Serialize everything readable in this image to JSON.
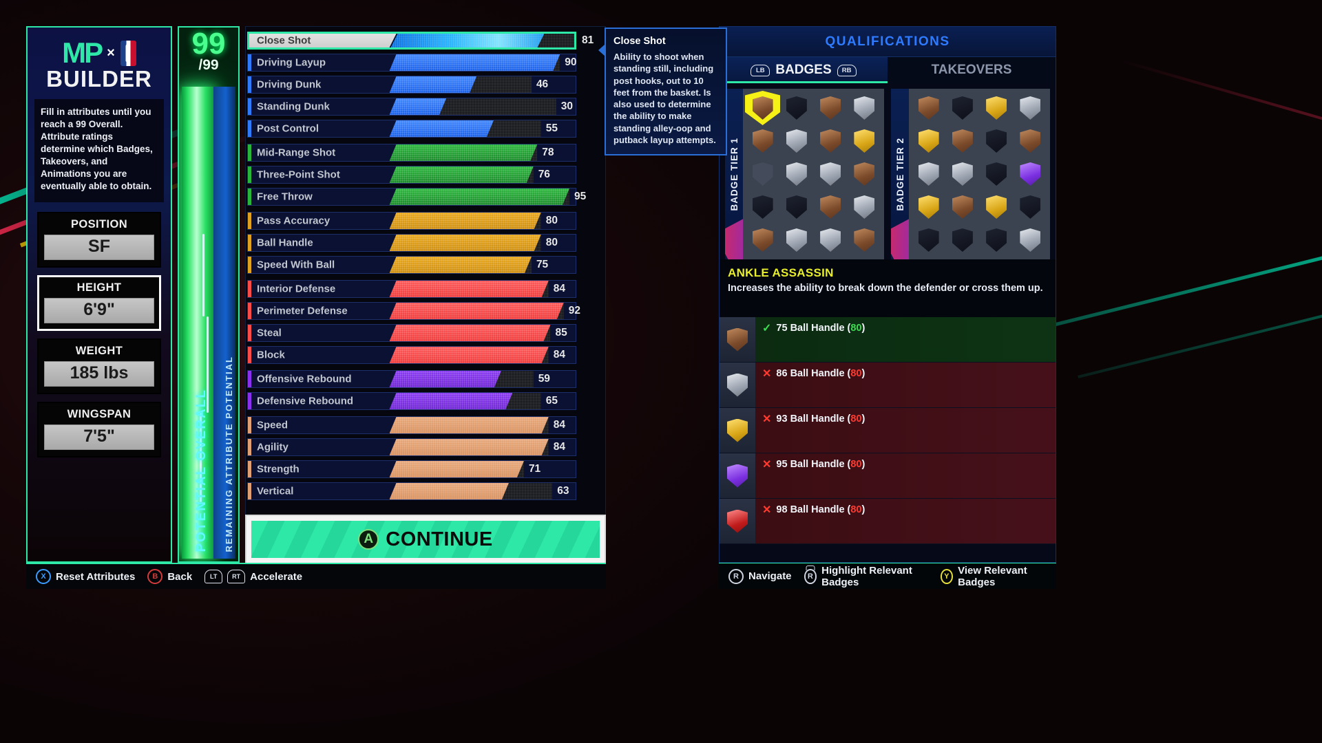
{
  "branding": {
    "mp_logo": "MP",
    "x_symbol": "×",
    "builder_word": "BUILDER",
    "description": "Fill in attributes until you reach a 99 Overall. Attribute ratings determine which Badges, Takeovers, and Animations you are eventually able to obtain."
  },
  "player": {
    "fields": [
      {
        "label": "POSITION",
        "value": "SF",
        "selected": false
      },
      {
        "label": "HEIGHT",
        "value": "6'9\"",
        "selected": true
      },
      {
        "label": "WEIGHT",
        "value": "185 lbs",
        "selected": false
      },
      {
        "label": "WINGSPAN",
        "value": "7'5\"",
        "selected": false
      }
    ]
  },
  "meter": {
    "overall": "99",
    "overall_max": "/99",
    "potential_label": "POTENTIAL OVERALL",
    "remaining_label": "REMAINING ATTRIBUTE POTENTIAL"
  },
  "attributes": [
    {
      "name": "Close Shot",
      "value": 81,
      "max": 99,
      "category": "inside",
      "selected": true,
      "gap": false
    },
    {
      "name": "Driving Layup",
      "value": 90,
      "max": 90,
      "category": "inside",
      "selected": false,
      "gap": false
    },
    {
      "name": "Driving Dunk",
      "value": 46,
      "max": 75,
      "category": "inside",
      "selected": false,
      "gap": false
    },
    {
      "name": "Standing Dunk",
      "value": 30,
      "max": 88,
      "category": "inside",
      "selected": false,
      "gap": false
    },
    {
      "name": "Post Control",
      "value": 55,
      "max": 80,
      "category": "inside",
      "selected": false,
      "gap": false
    },
    {
      "name": "Mid-Range Shot",
      "value": 78,
      "max": 78,
      "category": "shoot",
      "selected": false,
      "gap": true
    },
    {
      "name": "Three-Point Shot",
      "value": 76,
      "max": 76,
      "category": "shoot",
      "selected": false,
      "gap": false
    },
    {
      "name": "Free Throw",
      "value": 95,
      "max": 95,
      "category": "shoot",
      "selected": false,
      "gap": false
    },
    {
      "name": "Pass Accuracy",
      "value": 80,
      "max": 80,
      "category": "play",
      "selected": false,
      "gap": true
    },
    {
      "name": "Ball Handle",
      "value": 80,
      "max": 80,
      "category": "play",
      "selected": false,
      "gap": false
    },
    {
      "name": "Speed With Ball",
      "value": 75,
      "max": 75,
      "category": "play",
      "selected": false,
      "gap": false
    },
    {
      "name": "Interior Defense",
      "value": 84,
      "max": 84,
      "category": "def",
      "selected": false,
      "gap": true
    },
    {
      "name": "Perimeter Defense",
      "value": 92,
      "max": 92,
      "category": "def",
      "selected": false,
      "gap": false
    },
    {
      "name": "Steal",
      "value": 85,
      "max": 85,
      "category": "def",
      "selected": false,
      "gap": false
    },
    {
      "name": "Block",
      "value": 84,
      "max": 84,
      "category": "def",
      "selected": false,
      "gap": false
    },
    {
      "name": "Offensive Rebound",
      "value": 59,
      "max": 76,
      "category": "reb",
      "selected": false,
      "gap": true
    },
    {
      "name": "Defensive Rebound",
      "value": 65,
      "max": 80,
      "category": "reb",
      "selected": false,
      "gap": false
    },
    {
      "name": "Speed",
      "value": 84,
      "max": 84,
      "category": "ath",
      "selected": false,
      "gap": true
    },
    {
      "name": "Agility",
      "value": 84,
      "max": 84,
      "category": "ath",
      "selected": false,
      "gap": false
    },
    {
      "name": "Strength",
      "value": 71,
      "max": 71,
      "category": "ath",
      "selected": false,
      "gap": false
    },
    {
      "name": "Vertical",
      "value": 63,
      "max": 86,
      "category": "ath",
      "selected": false,
      "gap": false
    }
  ],
  "continue_button": {
    "button_glyph": "A",
    "label": "CONTINUE"
  },
  "tooltip": {
    "title": "Close Shot",
    "body": "Ability to shoot when standing still, including post hooks, out to 10 feet from the basket. Is also used to determine the ability to make standing alley-oop and putback layup attempts."
  },
  "qualifications": {
    "title": "QUALIFICATIONS",
    "tabs": [
      {
        "label": "BADGES",
        "bumper": "LB",
        "bumper_right": "RB",
        "active": true
      },
      {
        "label": "TAKEOVERS",
        "active": false
      }
    ],
    "tier1_label": "BADGE TIER 1",
    "tier2_label": "BADGE TIER 2",
    "tier1_badges": [
      {
        "tone": "bronze",
        "selected": true
      },
      {
        "tone": "dark"
      },
      {
        "tone": "bronze"
      },
      {
        "tone": "silver"
      },
      {
        "tone": "bronze"
      },
      {
        "tone": "silver"
      },
      {
        "tone": "bronze"
      },
      {
        "tone": "gold"
      },
      {
        "tone": "empty"
      },
      {
        "tone": "silver"
      },
      {
        "tone": "silver"
      },
      {
        "tone": "bronze"
      },
      {
        "tone": "dark"
      },
      {
        "tone": "dark"
      },
      {
        "tone": "bronze"
      },
      {
        "tone": "silver"
      },
      {
        "tone": "bronze"
      },
      {
        "tone": "silver"
      },
      {
        "tone": "silver"
      },
      {
        "tone": "bronze"
      }
    ],
    "tier2_badges": [
      {
        "tone": "bronze"
      },
      {
        "tone": "dark"
      },
      {
        "tone": "gold"
      },
      {
        "tone": "silver"
      },
      {
        "tone": "gold"
      },
      {
        "tone": "bronze"
      },
      {
        "tone": "dark"
      },
      {
        "tone": "bronze"
      },
      {
        "tone": "silver"
      },
      {
        "tone": "silver"
      },
      {
        "tone": "dark"
      },
      {
        "tone": "purple"
      },
      {
        "tone": "gold"
      },
      {
        "tone": "bronze"
      },
      {
        "tone": "gold"
      },
      {
        "tone": "dark"
      },
      {
        "tone": "dark"
      },
      {
        "tone": "dark"
      },
      {
        "tone": "dark"
      },
      {
        "tone": "silver"
      }
    ],
    "selected_badge": {
      "name": "ANKLE ASSASSIN",
      "description": "Increases the ability to break down the defender or cross them up."
    },
    "requirements": [
      {
        "mark": "✓",
        "met": true,
        "text_before": "75 Ball Handle (",
        "paren": "80",
        "text_after": ")",
        "tone": "bronze"
      },
      {
        "mark": "✕",
        "met": false,
        "text_before": "86 Ball Handle (",
        "paren": "80",
        "text_after": ")",
        "tone": "silver"
      },
      {
        "mark": "✕",
        "met": false,
        "text_before": "93 Ball Handle (",
        "paren": "80",
        "text_after": ")",
        "tone": "gold"
      },
      {
        "mark": "✕",
        "met": false,
        "text_before": "95 Ball Handle (",
        "paren": "80",
        "text_after": ")",
        "tone": "purple"
      },
      {
        "mark": "✕",
        "met": false,
        "text_before": "98 Ball Handle (",
        "paren": "80",
        "text_after": ")",
        "tone": "red"
      }
    ]
  },
  "footer_left": [
    {
      "glyph": "X",
      "glyph_kind": "x",
      "label": "Reset Attributes"
    },
    {
      "glyph": "B",
      "glyph_kind": "b",
      "label": "Back"
    },
    {
      "glyph": "LT",
      "glyph_kind": "trigger",
      "glyph2": "RT",
      "label": "Accelerate"
    }
  ],
  "footer_right": [
    {
      "glyph": "R",
      "glyph_kind": "stick",
      "label": "Navigate"
    },
    {
      "glyph": "R",
      "glyph_kind": "stick-press",
      "label": "Highlight Relevant Badges"
    },
    {
      "glyph": "Y",
      "glyph_kind": "y",
      "label": "View Relevant Badges"
    }
  ],
  "colors": {
    "accent_teal": "#2ee8a8",
    "accent_blue": "#2f7bff",
    "badge_yellow": "#e8ef2a",
    "met_green": "#3ddc52",
    "unmet_red": "#ff3b30"
  }
}
